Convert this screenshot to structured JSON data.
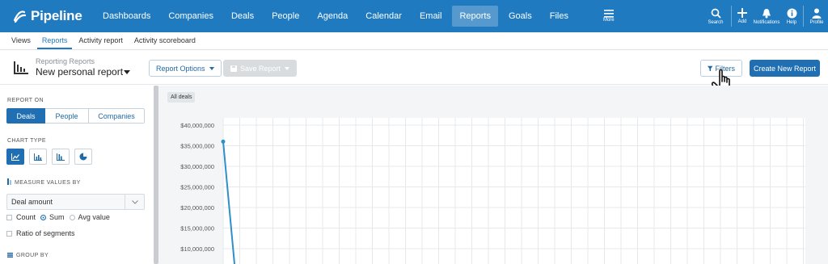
{
  "brand": {
    "name": "Pipeline",
    "color": "#1f7ac0"
  },
  "nav": {
    "items": [
      {
        "label": "Dashboards",
        "active": false
      },
      {
        "label": "Companies",
        "active": false
      },
      {
        "label": "Deals",
        "active": false
      },
      {
        "label": "People",
        "active": false
      },
      {
        "label": "Agenda",
        "active": false
      },
      {
        "label": "Calendar",
        "active": false
      },
      {
        "label": "Email",
        "active": false
      },
      {
        "label": "Reports",
        "active": true
      },
      {
        "label": "Goals",
        "active": false
      },
      {
        "label": "Files",
        "active": false
      }
    ],
    "more_label": "More",
    "tools": [
      {
        "label": "Search",
        "icon": "search-icon"
      },
      {
        "label": "Add",
        "icon": "plus-icon"
      },
      {
        "label": "Notifications",
        "icon": "bell-icon"
      },
      {
        "label": "Help",
        "icon": "info-icon"
      },
      {
        "label": "Profile",
        "icon": "user-icon"
      }
    ]
  },
  "subnav": {
    "tabs": [
      {
        "label": "Views",
        "active": false
      },
      {
        "label": "Reports",
        "active": true
      },
      {
        "label": "Activity report",
        "active": false
      },
      {
        "label": "Activity scoreboard",
        "active": false
      }
    ]
  },
  "header": {
    "breadcrumb": "Reporting Reports",
    "report_name": "New personal report",
    "report_options_label": "Report Options",
    "save_report_label": "Save Report",
    "filters_label": "Filters",
    "create_label": "Create New Report"
  },
  "left": {
    "report_on_label": "REPORT ON",
    "report_on": [
      "Deals",
      "People",
      "Companies"
    ],
    "report_on_selected": "Deals",
    "chart_type_label": "CHART TYPE",
    "chart_types": [
      "line-chart-icon",
      "bar-chart-icon",
      "column-chart-icon",
      "pie-chart-icon"
    ],
    "measure_label": "MEASURE VALUES BY",
    "measure_value": "Deal amount",
    "agg_count": "Count",
    "agg_sum": "Sum",
    "agg_avg": "Avg value",
    "ratio_label": "Ratio of segments",
    "group_by_label": "GROUP BY"
  },
  "chart": {
    "filter_pill": "All deals"
  },
  "chart_data": {
    "type": "line",
    "y_ticks": [
      "$40,000,000",
      "$35,000,000",
      "$30,000,000",
      "$25,000,000",
      "$20,000,000",
      "$15,000,000",
      "$10,000,000"
    ],
    "ylim": [
      5000000,
      40000000
    ],
    "series": [
      {
        "values": [
          36000000,
          5000000
        ],
        "color": "#2f8fc9"
      }
    ],
    "grid": true
  }
}
